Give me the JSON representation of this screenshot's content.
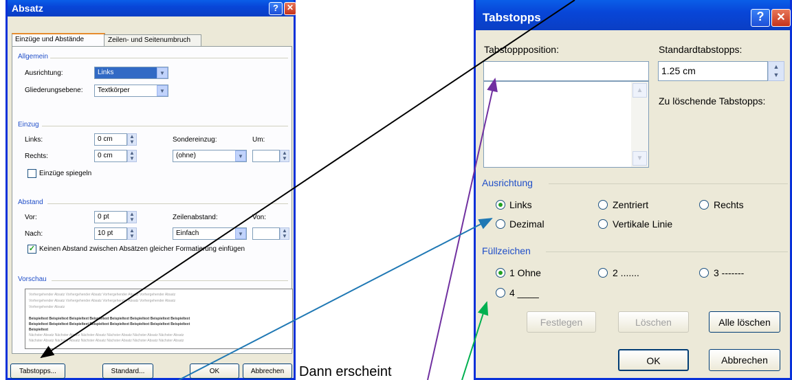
{
  "absatz": {
    "title": "Absatz",
    "tabs": [
      "Einzüge und Abstände",
      "Zeilen- und Seitenumbruch"
    ],
    "allgemein": {
      "heading": "Allgemein",
      "ausrichtung_label": "Ausrichtung:",
      "ausrichtung_value": "Links",
      "gliederung_label": "Gliederungsebene:",
      "gliederung_value": "Textkörper"
    },
    "einzug": {
      "heading": "Einzug",
      "links_label": "Links:",
      "links_value": "0 cm",
      "rechts_label": "Rechts:",
      "rechts_value": "0 cm",
      "sonder_label": "Sondereinzug:",
      "sonder_value": "(ohne)",
      "um_label": "Um:",
      "spiegeln_label": "Einzüge spiegeln"
    },
    "abstand": {
      "heading": "Abstand",
      "vor_label": "Vor:",
      "vor_value": "0 pt",
      "nach_label": "Nach:",
      "nach_value": "10 pt",
      "zeilen_label": "Zeilenabstand:",
      "zeilen_value": "Einfach",
      "von_label": "Von:",
      "keinen_label": "Keinen Abstand zwischen Absätzen gleicher Formatierung einfügen"
    },
    "vorschau": {
      "heading": "Vorschau",
      "prev_line": "Vorhergehender Absatz Vorhergehender Absatz Vorhergehender Absatz Vorhergehender Absatz",
      "prev_short": "Vorhergehender Absatz",
      "sample_line": "Beispieltext Beispieltext Beispieltext Beispieltext Beispieltext Beispieltext Beispieltext Beispieltext",
      "sample_short": "Beispieltext",
      "next_line": "Nächster Absatz Nächster Absatz Nächster Absatz Nächster Absatz Nächster Absatz Nächster Absatz"
    },
    "buttons": {
      "tabstopps": "Tabstopps...",
      "standard": "Standard...",
      "ok": "OK",
      "abbrechen": "Abbrechen"
    }
  },
  "caption": "Dann erscheint",
  "tabstopps": {
    "title": "Tabstopps",
    "position_label": "Tabstoppposition:",
    "position_value": "",
    "standard_label": "Standardtabstopps:",
    "standard_value": "1.25 cm",
    "loeschen_label": "Zu löschende Tabstopps:",
    "ausrichtung": {
      "heading": "Ausrichtung",
      "links": "Links",
      "zentriert": "Zentriert",
      "rechts": "Rechts",
      "dezimal": "Dezimal",
      "vertikal": "Vertikale Linie"
    },
    "fuellzeichen": {
      "heading": "Füllzeichen",
      "opt1": "1 Ohne",
      "opt2": "2 .......",
      "opt3": "3 -------",
      "opt4": "4 ____"
    },
    "buttons": {
      "festlegen": "Festlegen",
      "loeschen": "Löschen",
      "alle_loeschen": "Alle löschen",
      "ok": "OK",
      "abbrechen": "Abbrechen"
    }
  },
  "icons": {
    "help": "?",
    "close": "✕",
    "spin_up": "▲",
    "spin_down": "▼",
    "dropdown": "▼"
  },
  "colors": {
    "titlebar": "#0a4fd6",
    "dialog_bg": "#ece9d8",
    "group_heading": "#1f4ec8",
    "arrow_black": "#000000",
    "arrow_purple": "#7030a0",
    "arrow_blue": "#1f78b4",
    "arrow_green": "#00b050"
  }
}
